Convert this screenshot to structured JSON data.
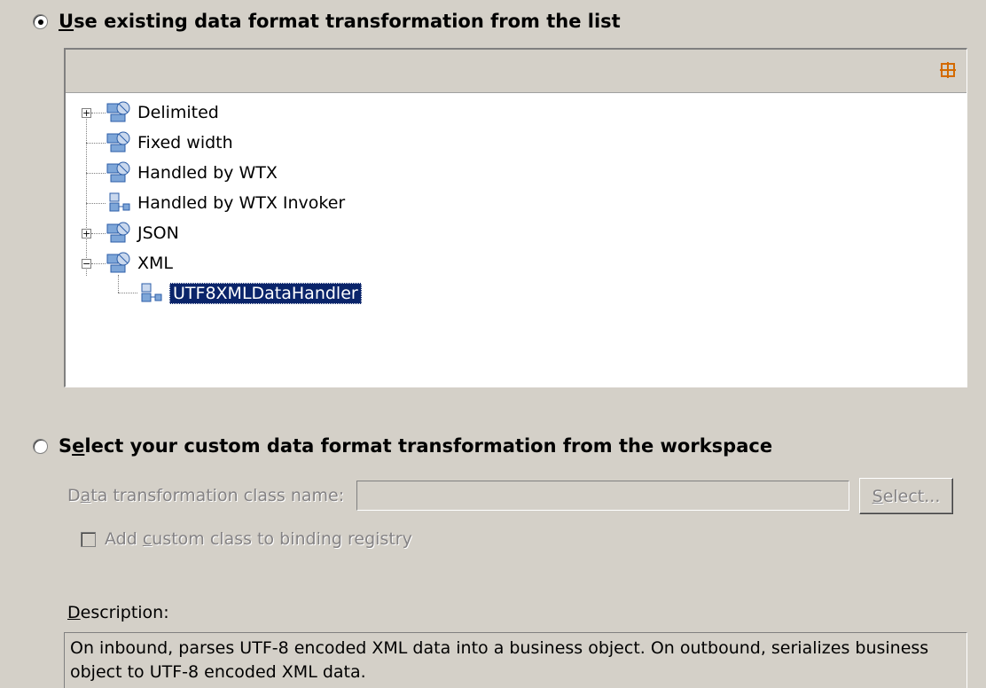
{
  "option_existing": {
    "label_prefix": "U",
    "label_rest": "se existing data format transformation from the list",
    "selected": true
  },
  "tree": {
    "toolbar_icon": "maximize-icon",
    "items": [
      {
        "label": "Delimited",
        "expandable": true,
        "expanded": false,
        "icon": "transformation-group-icon"
      },
      {
        "label": "Fixed width",
        "expandable": false,
        "icon": "transformation-group-icon"
      },
      {
        "label": "Handled by WTX",
        "expandable": false,
        "icon": "transformation-group-icon"
      },
      {
        "label": "Handled by WTX Invoker",
        "expandable": false,
        "icon": "data-handler-icon"
      },
      {
        "label": "JSON",
        "expandable": true,
        "expanded": false,
        "icon": "transformation-group-icon"
      },
      {
        "label": "XML",
        "expandable": true,
        "expanded": true,
        "icon": "transformation-group-icon"
      },
      {
        "label": "UTF8XMLDataHandler",
        "selected": true,
        "icon": "data-handler-icon"
      }
    ]
  },
  "option_custom": {
    "label_prefix": "S",
    "label_mid": "e",
    "label_rest": "lect your custom data format transformation from the workspace",
    "selected": false
  },
  "class_name": {
    "label_prefix": "D",
    "label_mid": "a",
    "label_rest": "ta transformation class name:",
    "value": ""
  },
  "select_button": {
    "label_underlined": "S",
    "label_rest": "elect..."
  },
  "registry_checkbox": {
    "label_prefix": "Add ",
    "label_underlined": "c",
    "label_rest": "ustom class to binding registry",
    "checked": false
  },
  "description": {
    "label_underlined": "D",
    "label_rest": "escription:",
    "text": "On inbound, parses UTF-8 encoded XML data into a business object. On outbound, serializes business object to UTF-8 encoded XML data."
  }
}
